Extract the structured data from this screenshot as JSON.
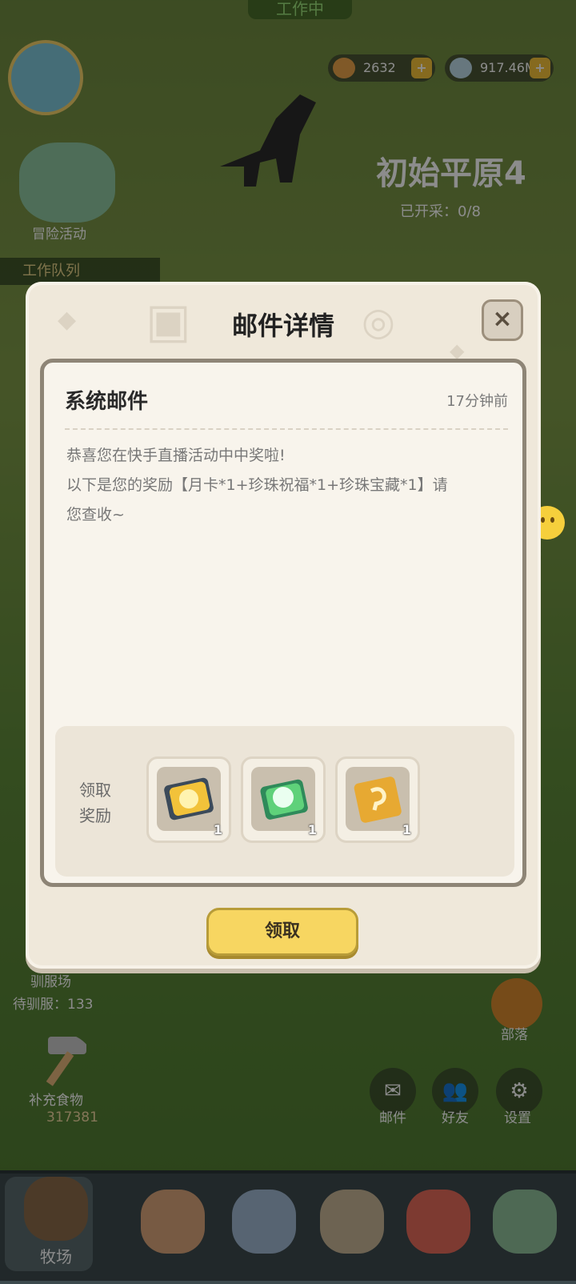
{
  "status": {
    "working_label": "工作中"
  },
  "resources": {
    "amber": "2632",
    "shells": "917.46M"
  },
  "area": {
    "title": "初始平原4",
    "mining_status": "已开采：0/8"
  },
  "left_menu": {
    "adventure": "冒险活动",
    "work_queue": "工作队列",
    "taming_field": "驯服场",
    "taming_pending": "待驯服：133",
    "add_food": "补充食物",
    "food_count": "317381"
  },
  "right_menu": {
    "chat": "聊天",
    "tribe": "部落"
  },
  "bottom_buttons": {
    "mail": "邮件",
    "friends": "好友",
    "settings": "设置"
  },
  "nav": {
    "ranch": "牧场"
  },
  "dialog": {
    "title": "邮件详情",
    "close": "×",
    "mail_type": "系统邮件",
    "time_ago": "17分钟前",
    "body_line1": "恭喜您在快手直播活动中中奖啦!",
    "body_line2": "以下是您的奖励【月卡*1+珍珠祝福*1+珍珠宝藏*1】请",
    "body_line3": "您查收~",
    "reward_label": "领取奖励",
    "rewards": [
      {
        "icon": "monthly-card-icon",
        "qty": "1",
        "color": "#f2c23a"
      },
      {
        "icon": "pearl-blessing-icon",
        "qty": "1",
        "color": "#5fd17a"
      },
      {
        "icon": "pearl-treasure-icon",
        "qty": "1",
        "color": "#e7a932"
      }
    ],
    "claim_label": "领取"
  }
}
